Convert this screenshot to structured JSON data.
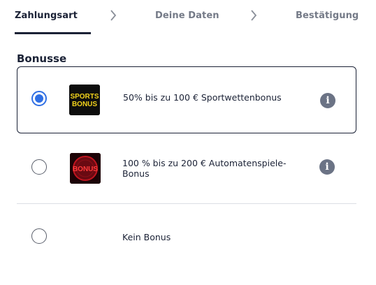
{
  "steps": [
    {
      "label": "Zahlungsart",
      "state": "active"
    },
    {
      "label": "Deine Daten",
      "state": "inactive"
    },
    {
      "label": "Bestätigung",
      "state": "inactive"
    }
  ],
  "bonus_section": {
    "title": "Bonusse",
    "options": [
      {
        "label": "50% bis zu 100 € Sportwettenbonus",
        "selected": true,
        "thumbnail_icon": "sports-bonus-logo",
        "thumbnail_text": [
          "SPORTS",
          "BONUS"
        ],
        "info_glyph": "i"
      },
      {
        "label": "100 % bis zu 200 € Automatenspiele-Bonus",
        "label_line1": "100 % bis zu 200 € Automatenspiele-",
        "label_line2": "Bonus",
        "selected": false,
        "thumbnail_icon": "casino-bonus-logo",
        "thumbnail_text": [
          "BONUS"
        ],
        "info_glyph": "i"
      },
      {
        "label": "Kein Bonus",
        "selected": false
      }
    ]
  },
  "colors": {
    "primary_text": "#1b2236",
    "muted_text": "#747a87",
    "radio_selected": "#2f6fe4",
    "info_icon": "#6b7385"
  }
}
